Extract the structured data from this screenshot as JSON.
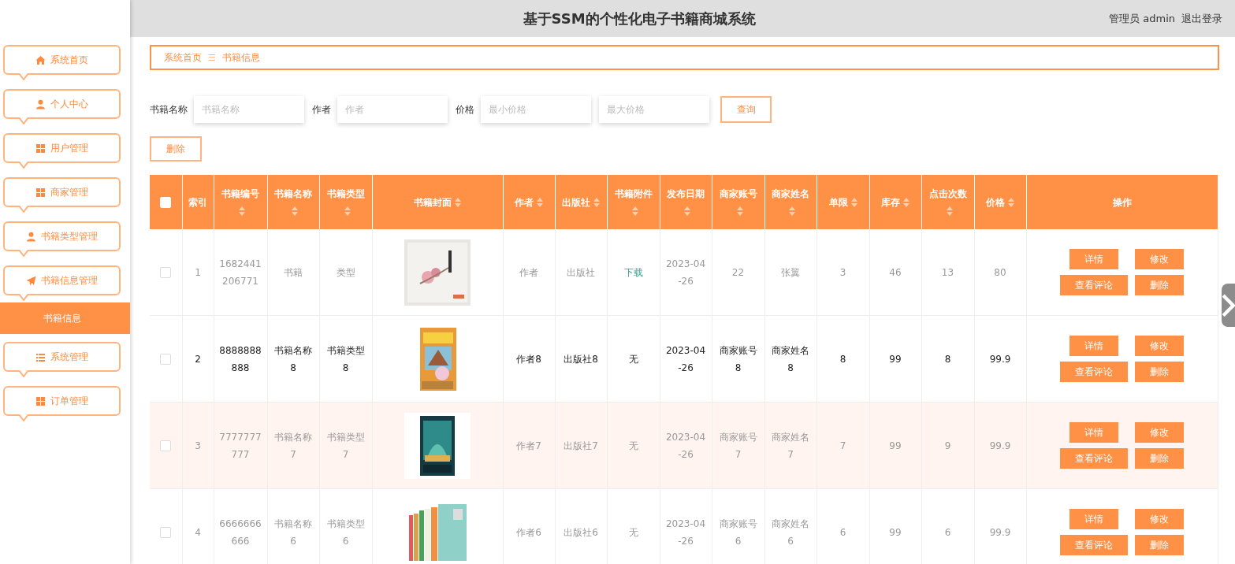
{
  "header": {
    "title": "基于SSM的个性化电子书籍商城系统",
    "user": "管理员 admin",
    "logout": "退出登录"
  },
  "sidebar": {
    "items": [
      {
        "label": "系统首页",
        "selected": false
      },
      {
        "label": "个人中心",
        "selected": false
      },
      {
        "label": "用户管理",
        "selected": false
      },
      {
        "label": "商家管理",
        "selected": false
      },
      {
        "label": "书籍类型管理",
        "selected": false
      },
      {
        "label": "书籍信息管理",
        "selected": false,
        "children": [
          {
            "label": "书籍信息",
            "selected": true
          }
        ]
      },
      {
        "label": "系统管理",
        "selected": false
      },
      {
        "label": "订单管理",
        "selected": false
      }
    ]
  },
  "breadcrumb": {
    "home": "系统首页",
    "separator": "☰",
    "current": "书籍信息"
  },
  "search": {
    "fields": [
      {
        "label": "书籍名称",
        "placeholder": "书籍名称"
      },
      {
        "label": "作者",
        "placeholder": "作者"
      },
      {
        "label": "价格",
        "placeholder": "最小价格"
      },
      {
        "placeholder": "最大价格"
      }
    ],
    "button": "查询"
  },
  "delete_button": "删除",
  "table": {
    "select_all": {
      "checked": false
    },
    "columns": [
      {
        "label": "索引",
        "sortable": false
      },
      {
        "label": "书籍编号",
        "sortable": true
      },
      {
        "label": "书籍名称",
        "sortable": true
      },
      {
        "label": "书籍类型",
        "sortable": true
      },
      {
        "label": "书籍封面",
        "sortable": true
      },
      {
        "label": "作者",
        "sortable": true
      },
      {
        "label": "出版社",
        "sortable": true
      },
      {
        "label": "书籍附件",
        "sortable": true
      },
      {
        "label": "发布日期",
        "sortable": true
      },
      {
        "label": "商家账号",
        "sortable": true
      },
      {
        "label": "商家姓名",
        "sortable": true
      },
      {
        "label": "单限",
        "sortable": true
      },
      {
        "label": "库存",
        "sortable": true
      },
      {
        "label": "点击次数",
        "sortable": true
      },
      {
        "label": "价格",
        "sortable": true
      },
      {
        "label": "操作",
        "sortable": false
      }
    ],
    "rows": [
      {
        "checked": false,
        "emphasized": false,
        "striped": false,
        "index": "1",
        "code": "1682441206771",
        "name": "书籍",
        "type": "类型",
        "author": "作者",
        "publisher": "出版社",
        "attachment": {
          "kind": "link",
          "text": "下载"
        },
        "date": "2023-04-26",
        "merchant_account": "22",
        "merchant_name": "张翼",
        "limit": "3",
        "stock": "46",
        "clicks": "13",
        "price": "80",
        "actions": [
          "详情",
          "修改",
          "查看评论",
          "删除"
        ]
      },
      {
        "checked": false,
        "emphasized": true,
        "striped": false,
        "index": "2",
        "code": "8888888888",
        "name": "书籍名称8",
        "type": "书籍类型8",
        "author": "作者8",
        "publisher": "出版社8",
        "attachment": {
          "kind": "text",
          "text": "无"
        },
        "date": "2023-04-26",
        "merchant_account": "商家账号8",
        "merchant_name": "商家姓名8",
        "limit": "8",
        "stock": "99",
        "clicks": "8",
        "price": "99.9",
        "actions": [
          "详情",
          "修改",
          "查看评论",
          "删除"
        ]
      },
      {
        "checked": false,
        "emphasized": false,
        "striped": true,
        "index": "3",
        "code": "7777777777",
        "name": "书籍名称7",
        "type": "书籍类型7",
        "author": "作者7",
        "publisher": "出版社7",
        "attachment": {
          "kind": "text",
          "text": "无"
        },
        "date": "2023-04-26",
        "merchant_account": "商家账号7",
        "merchant_name": "商家姓名7",
        "limit": "7",
        "stock": "99",
        "clicks": "9",
        "price": "99.9",
        "actions": [
          "详情",
          "修改",
          "查看评论",
          "删除"
        ]
      },
      {
        "checked": false,
        "emphasized": false,
        "striped": false,
        "index": "4",
        "code": "6666666666",
        "name": "书籍名称6",
        "type": "书籍类型6",
        "author": "作者6",
        "publisher": "出版社6",
        "attachment": {
          "kind": "text",
          "text": "无"
        },
        "date": "2023-04-26",
        "merchant_account": "商家账号6",
        "merchant_name": "商家姓名6",
        "limit": "6",
        "stock": "99",
        "clicks": "6",
        "price": "99.9",
        "actions": [
          "详情",
          "修改",
          "查看评论",
          "删除"
        ]
      }
    ]
  }
}
